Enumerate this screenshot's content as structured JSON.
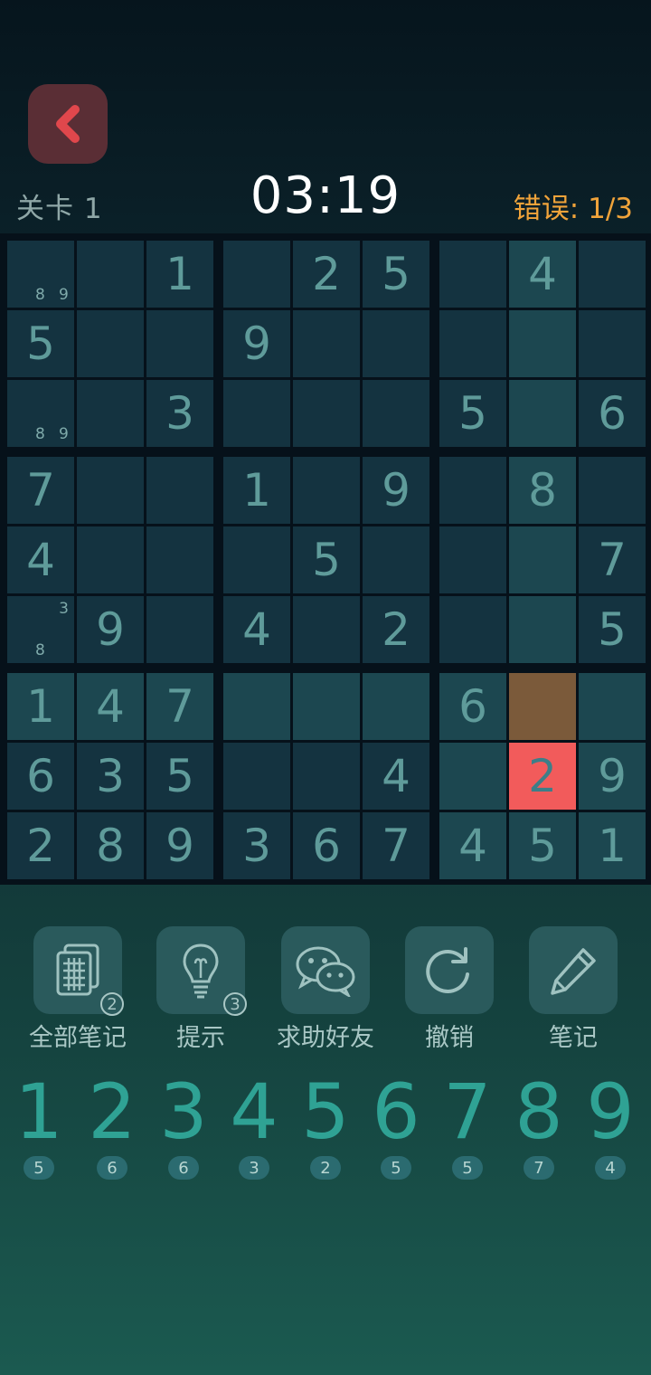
{
  "header": {
    "level": "关卡 1",
    "timer": "03:19",
    "errors_label": "错误:",
    "errors_value": "1/3"
  },
  "board": {
    "rows": [
      [
        "",
        "",
        "1",
        "",
        "2",
        "5",
        "",
        "4",
        ""
      ],
      [
        "5",
        "",
        "",
        "9",
        "",
        "",
        "",
        "",
        ""
      ],
      [
        "",
        "",
        "3",
        "",
        "",
        "",
        "5",
        "",
        "6"
      ],
      [
        "7",
        "",
        "",
        "1",
        "",
        "9",
        "",
        "8",
        ""
      ],
      [
        "4",
        "",
        "",
        "",
        "5",
        "",
        "",
        "",
        "7"
      ],
      [
        "",
        "9",
        "",
        "4",
        "",
        "2",
        "",
        "",
        "5"
      ],
      [
        "1",
        "4",
        "7",
        "",
        "",
        "",
        "6",
        "",
        ""
      ],
      [
        "6",
        "3",
        "5",
        "",
        "",
        "4",
        "",
        "2",
        "9"
      ],
      [
        "2",
        "8",
        "9",
        "3",
        "6",
        "7",
        "4",
        "5",
        "1"
      ]
    ],
    "notes": [
      {
        "row": 0,
        "col": 0,
        "digits": [
          "8",
          "9"
        ]
      },
      {
        "row": 2,
        "col": 0,
        "digits": [
          "8",
          "9"
        ]
      },
      {
        "row": 5,
        "col": 0,
        "digits": [
          "3",
          "8"
        ]
      }
    ],
    "selected": {
      "row": 6,
      "col": 7
    },
    "error": {
      "row": 7,
      "col": 7
    }
  },
  "tools": [
    {
      "label": "全部笔记",
      "icon": "all-notes-icon",
      "badge": "2"
    },
    {
      "label": "提示",
      "icon": "lightbulb-icon",
      "badge": "3"
    },
    {
      "label": "求助好友",
      "icon": "wechat-icon",
      "badge": ""
    },
    {
      "label": "撤销",
      "icon": "undo-icon",
      "badge": ""
    },
    {
      "label": "笔记",
      "icon": "pencil-icon",
      "badge": ""
    }
  ],
  "numpad": {
    "digits": [
      "1",
      "2",
      "3",
      "4",
      "5",
      "6",
      "7",
      "8",
      "9"
    ],
    "counts": [
      "5",
      "6",
      "6",
      "3",
      "2",
      "5",
      "5",
      "7",
      "4"
    ]
  },
  "colors": {
    "error_cell": "#f25b5b",
    "selected_cell": "#7b5a3a",
    "errors_text": "#f0a33a",
    "digit": "#2fa294"
  }
}
